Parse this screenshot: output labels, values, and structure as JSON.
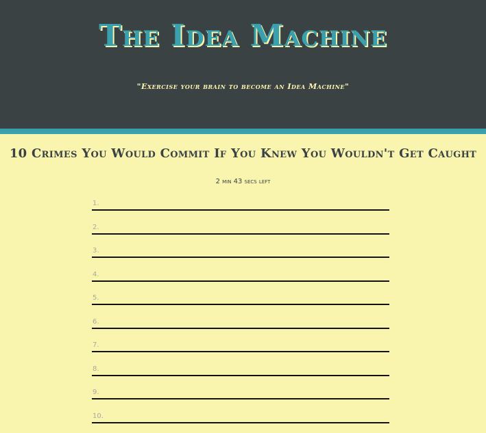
{
  "header": {
    "title": "The Idea Machine",
    "tagline": "\"Exercise your brain to become an Idea Machine\""
  },
  "prompt": {
    "title": "10 Crimes You Would Commit If You Knew You Wouldn't Get Caught",
    "timer": "2 min 43 secs left"
  },
  "ideas": [
    {
      "number": "1.",
      "value": ""
    },
    {
      "number": "2.",
      "value": ""
    },
    {
      "number": "3.",
      "value": ""
    },
    {
      "number": "4.",
      "value": ""
    },
    {
      "number": "5.",
      "value": ""
    },
    {
      "number": "6.",
      "value": ""
    },
    {
      "number": "7.",
      "value": ""
    },
    {
      "number": "8.",
      "value": ""
    },
    {
      "number": "9.",
      "value": ""
    },
    {
      "number": "10.",
      "value": ""
    }
  ],
  "colors": {
    "header_bg": "#3a4244",
    "accent": "#3aa0ad",
    "page_bg": "#f9f4ae",
    "placeholder": "#a8a8a0"
  }
}
